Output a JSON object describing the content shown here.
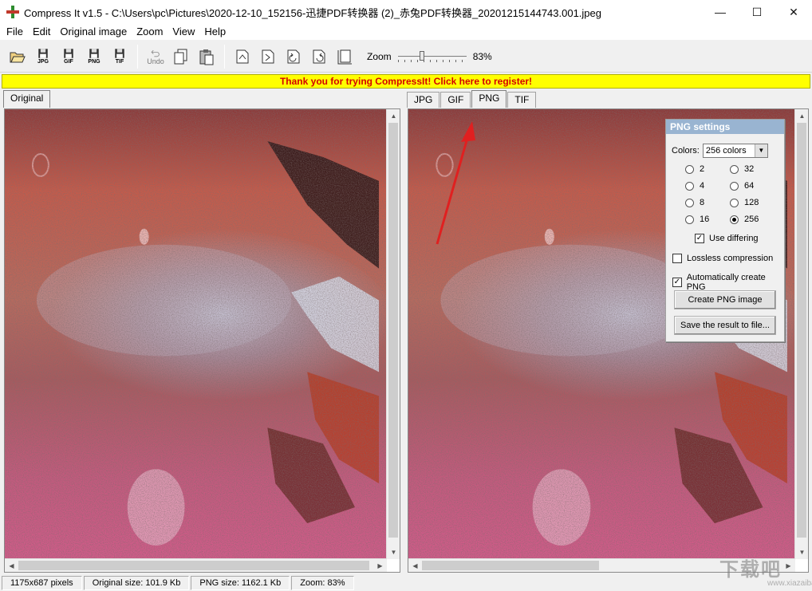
{
  "window": {
    "title": "Compress It v1.5 - C:\\Users\\pc\\Pictures\\2020-12-10_152156-迅捷PDF转换器 (2)_赤兔PDF转换器_20201215144743.001.jpeg",
    "minimize": "—",
    "maximize": "☐",
    "close": "✕"
  },
  "menu": [
    "File",
    "Edit",
    "Original image",
    "Zoom",
    "View",
    "Help"
  ],
  "toolbar": {
    "open_icon": "folder-open-icon",
    "jpg_label": "JPG",
    "gif_label": "GIF",
    "png_label": "PNG",
    "tif_label": "TIF",
    "undo_label": "Undo",
    "zoom_label": "Zoom",
    "zoom_value": "83%",
    "zoom_level": 0.83
  },
  "banner": {
    "text": "Thank you for trying CompressIt! Click here to register!"
  },
  "left_tabs": [
    "Original"
  ],
  "right_tabs": [
    "JPG",
    "GIF",
    "PNG",
    "TIF"
  ],
  "right_active_tab": "PNG",
  "png_settings": {
    "title": "PNG settings",
    "colors_label": "Colors:",
    "colors_value": "256 colors",
    "radios": [
      "2",
      "32",
      "4",
      "64",
      "8",
      "128",
      "16",
      "256"
    ],
    "selected": "256",
    "use_differing": "Use differing",
    "lossless": "Lossless compression",
    "auto_create": "Automatically create PNG",
    "create_button": "Create PNG image",
    "save_button": "Save the result to file..."
  },
  "status": {
    "dimensions": "1175x687 pixels",
    "original_size": "Original size: 101.9 Kb",
    "png_size": "PNG size: 1162.1 Kb",
    "zoom": "Zoom: 83%"
  },
  "watermark": {
    "text": "下载吧",
    "url": "www.xiazaiba.com"
  },
  "colors": {
    "banner_bg": "#ffff00",
    "banner_text": "#d40000",
    "panel_header": "#99b4d1",
    "annotation_arrow": "#e02020"
  }
}
